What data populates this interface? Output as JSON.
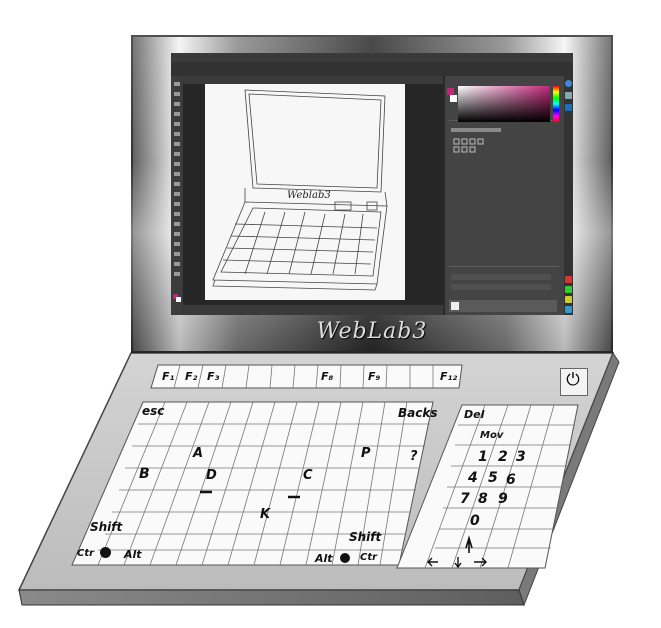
{
  "brand": {
    "text": "WebLab3"
  },
  "sketch_label": "Weblab3",
  "function_row": {
    "keys": [
      "F₁",
      "F₂",
      "F₃",
      "F₈",
      "F₉",
      "F₁₂"
    ]
  },
  "main_keyboard": {
    "esc": "esc",
    "backspace": "Backs",
    "letters": [
      "A",
      "P",
      "B",
      "D",
      "C",
      "K"
    ],
    "question": "?",
    "shift_left": "Shift",
    "shift_right": "Shift",
    "ctrl_left": "Ctr",
    "alt_left": "Alt",
    "alt_right": "Alt",
    "ctrl_right": "Ctr"
  },
  "numpad": {
    "del": "Del",
    "mov": "Mov",
    "digits": [
      "1",
      "2",
      "3",
      "4",
      "5",
      "6",
      "7",
      "8",
      "9",
      "0"
    ]
  },
  "power": {
    "icon": "power-icon"
  },
  "colors": {
    "screen_bg": "#2b2b2b",
    "panel_bg": "#444444",
    "base": "#c8c8c8",
    "accent": "#c0287a"
  }
}
